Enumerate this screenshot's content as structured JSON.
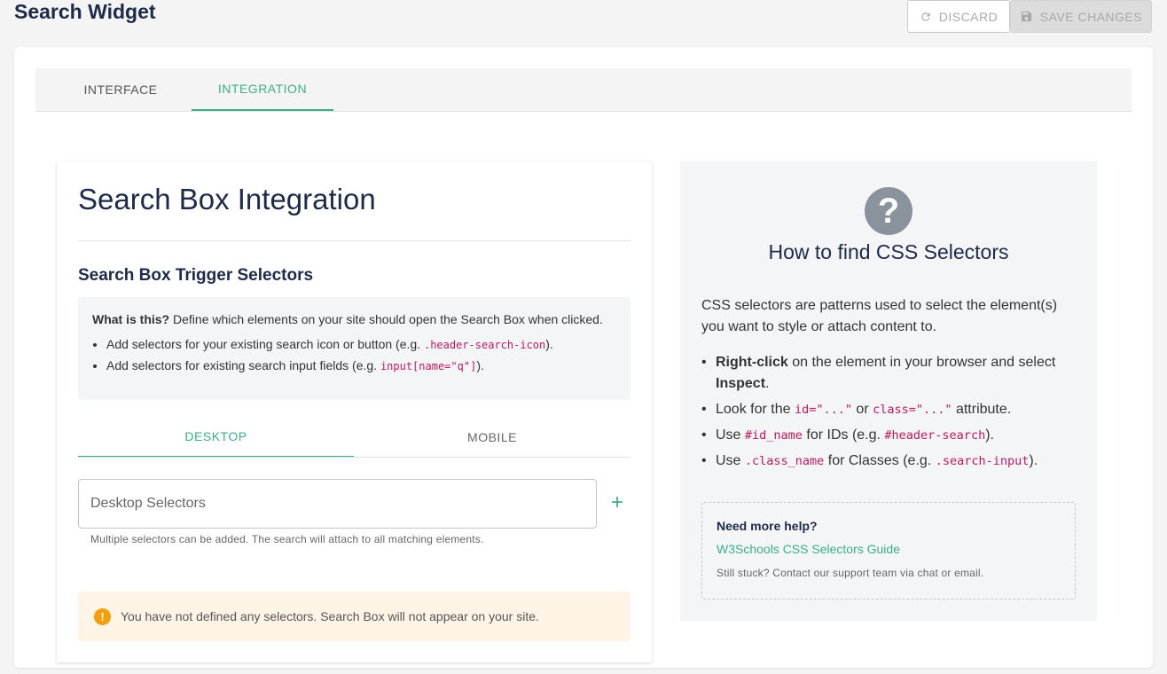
{
  "header": {
    "title": "Search Widget",
    "discard_label": "DISCARD",
    "save_label": "SAVE CHANGES"
  },
  "tabs": [
    {
      "label": "INTERFACE",
      "active": false
    },
    {
      "label": "INTEGRATION",
      "active": true
    }
  ],
  "integration": {
    "heading": "Search Box Integration",
    "subheading": "Search Box Trigger Selectors",
    "info": {
      "what_label": "What is this?",
      "what_text": " Define which elements on your site should open the Search Box when clicked.",
      "items": [
        {
          "prefix": "Add selectors for your existing search icon or button (e.g. ",
          "code": ".header-search-icon",
          "suffix": ")."
        },
        {
          "prefix": "Add selectors for existing search input fields (e.g. ",
          "code": "input[name=\"q\"]",
          "suffix": ")."
        }
      ]
    },
    "device_tabs": [
      {
        "label": "DESKTOP",
        "active": true
      },
      {
        "label": "MOBILE",
        "active": false
      }
    ],
    "selector_input": {
      "value": "",
      "placeholder": "Desktop Selectors"
    },
    "add_label": "+",
    "hint": "Multiple selectors can be added. The search will attach to all matching elements.",
    "warning": "You have not defined any selectors. Search Box will not appear on your site."
  },
  "help": {
    "icon_label": "?",
    "title": "How to find CSS Selectors",
    "intro": "CSS selectors are patterns used to select the element(s) you want to style or attach content to.",
    "steps": {
      "s1_bold": "Right-click",
      "s1_text": " on the element in your browser and select ",
      "s1_bold2": "Inspect",
      "s1_end": ".",
      "s2_text": "Look for the ",
      "s2_code1": "id=\"...\"",
      "s2_mid": " or ",
      "s2_code2": "class=\"...\"",
      "s2_end": " attribute.",
      "s3_text": "Use ",
      "s3_code": "#id_name",
      "s3_mid": " for IDs (e.g. ",
      "s3_code2": "#header-search",
      "s3_end": ").",
      "s4_text": "Use ",
      "s4_code": ".class_name",
      "s4_mid": " for Classes (e.g. ",
      "s4_code2": ".search-input",
      "s4_end": ")."
    },
    "need_more": "Need more help?",
    "link_label": "W3Schools CSS Selectors Guide",
    "stuck": "Still stuck? Contact our support team via chat or email."
  },
  "colors": {
    "accent": "#3aaf85",
    "title": "#1e2a4a",
    "warning": "#f59e0b",
    "code": "#c2185b"
  },
  "icons": [
    "refresh-icon",
    "save-icon",
    "plus-icon",
    "warning-icon",
    "help-icon"
  ]
}
